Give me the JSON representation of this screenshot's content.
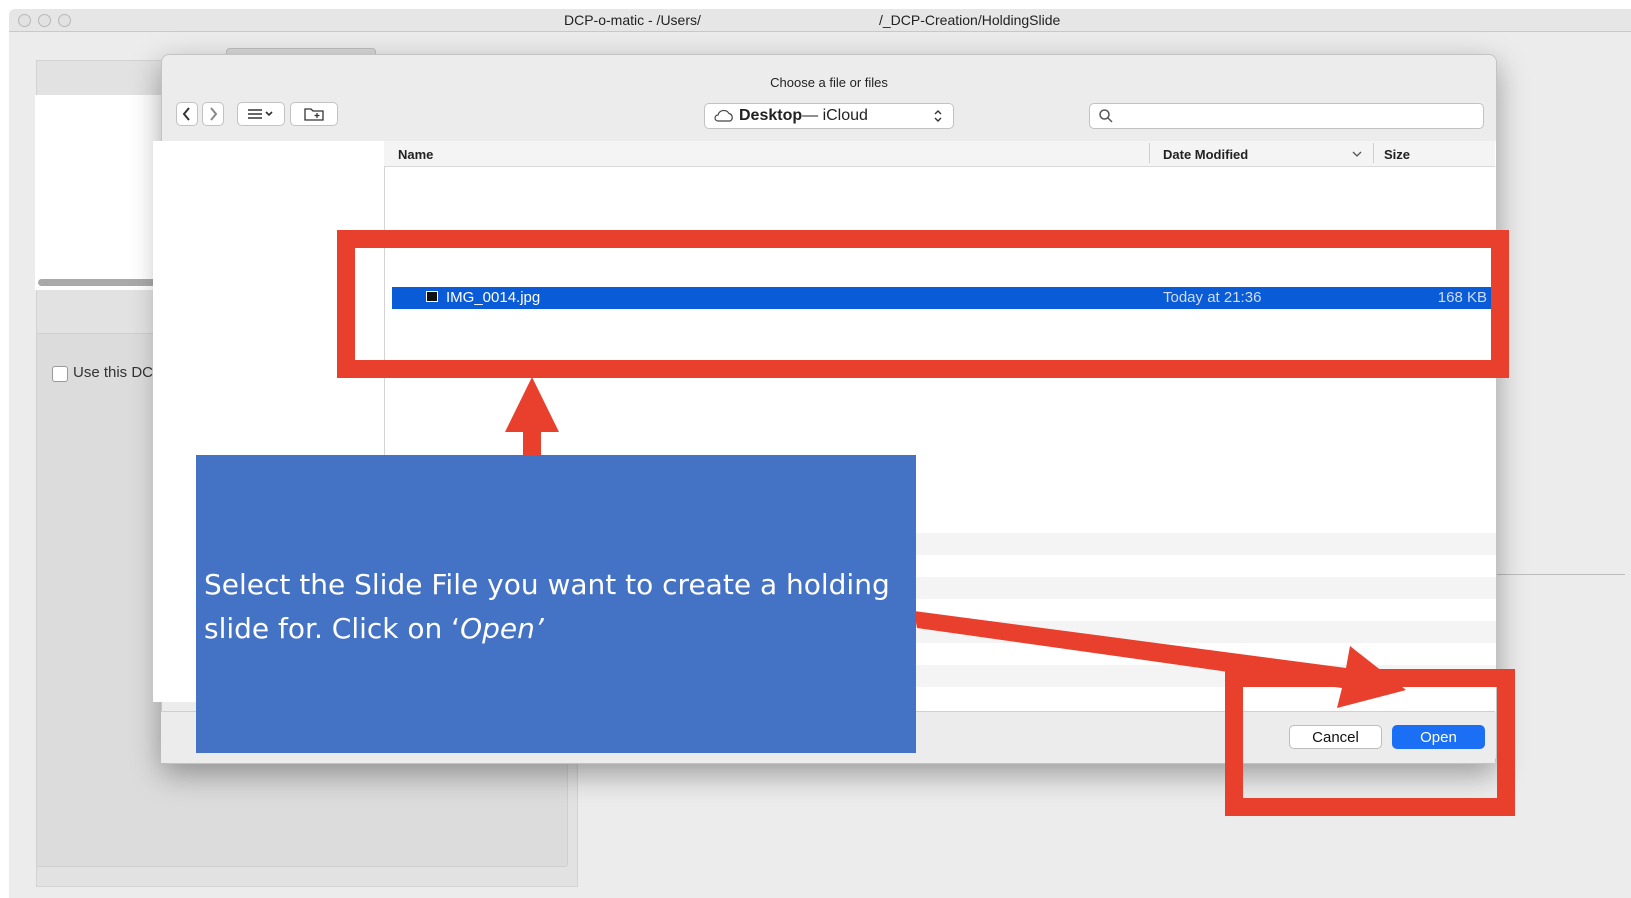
{
  "app": {
    "title_left": "DCP-o-matic - /Users/",
    "title_right": "/_DCP-Creation/HoldingSlide",
    "background": {
      "checkbox_label": "Use this DC"
    }
  },
  "dialog": {
    "title": "Choose a file or files",
    "toolbar": {
      "back_icon": "chevron-left-icon",
      "forward_icon": "chevron-right-icon",
      "view_icon": "list-view-icon",
      "new_folder_icon": "new-folder-icon"
    },
    "location": {
      "bold": "Desktop",
      "rest": " — iCloud"
    },
    "search": {
      "placeholder": ""
    },
    "columns": {
      "name": "Name",
      "date_modified": "Date Modified",
      "size": "Size"
    },
    "files": [
      {
        "name": "IMG_0014.jpg",
        "date": "Today at 21:36",
        "size": "168 KB",
        "selected": true
      }
    ],
    "buttons": {
      "cancel": "Cancel",
      "open": "Open"
    }
  },
  "annotation": {
    "text_plain": "Select the Slide File you want to create a holding slide for. Click on ‘",
    "text_italic": "Open’",
    "box_color": "#e8402d",
    "callout_color": "#4472c4"
  }
}
